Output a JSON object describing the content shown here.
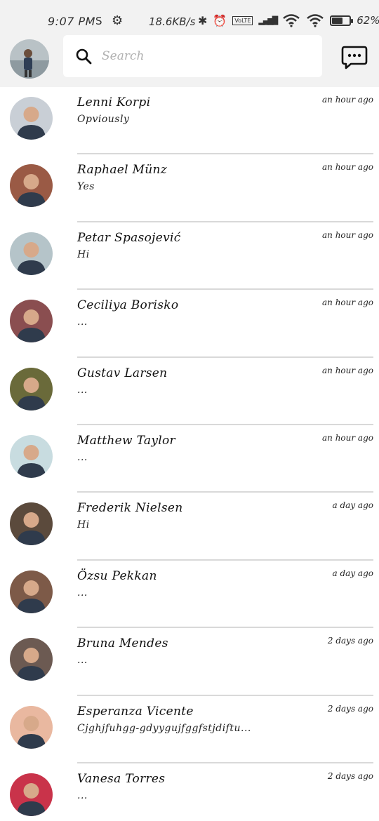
{
  "status_bar": {
    "time": "9:07 PM",
    "sim_glyph": "S",
    "gear_glyph": "⚙",
    "speed": "18.6KB/s",
    "bluetooth_glyph": "✱",
    "alarm_glyph": "⏰",
    "volte": "VoLTE",
    "signal_glyph": "▂▄▆█",
    "wifi_glyph": "◠",
    "battery_level": 0.62,
    "battery_percent": "62%"
  },
  "header": {
    "search_placeholder": "Search",
    "icons": [
      "profile-avatar",
      "search-icon",
      "new-chat-icon"
    ]
  },
  "conversations": [
    {
      "name": "Lenni Korpi",
      "preview": "Opviously",
      "time": "an hour ago",
      "avatar_color": "#c9cfd6"
    },
    {
      "name": "Raphael Münz",
      "preview": "Yes",
      "time": "an hour ago",
      "avatar_color": "#9a5a45"
    },
    {
      "name": "Petar Spasojević",
      "preview": "Hi",
      "time": "an hour ago",
      "avatar_color": "#b5c4c9"
    },
    {
      "name": "Ceciliya Borisko",
      "preview": "...",
      "time": "an hour ago",
      "avatar_color": "#8a4e50"
    },
    {
      "name": "Gustav Larsen",
      "preview": "...",
      "time": "an hour ago",
      "avatar_color": "#6a6a3a"
    },
    {
      "name": "Matthew Taylor",
      "preview": "...",
      "time": "an hour ago",
      "avatar_color": "#c8dce0"
    },
    {
      "name": "Frederik Nielsen",
      "preview": "Hi",
      "time": "a day ago",
      "avatar_color": "#5b4a3c"
    },
    {
      "name": "Özsu Pekkan",
      "preview": "...",
      "time": "a day ago",
      "avatar_color": "#7d5a48"
    },
    {
      "name": "Bruna Mendes",
      "preview": "...",
      "time": "2 days ago",
      "avatar_color": "#6c5a52"
    },
    {
      "name": "Esperanza Vicente",
      "preview": "Cjghjfuhgg-gdyygujfggfstjdiftu...",
      "time": "2 days ago",
      "avatar_color": "#e9b8a0"
    },
    {
      "name": "Vanesa Torres",
      "preview": "...",
      "time": "2 days ago",
      "avatar_color": "#c9334a"
    }
  ]
}
